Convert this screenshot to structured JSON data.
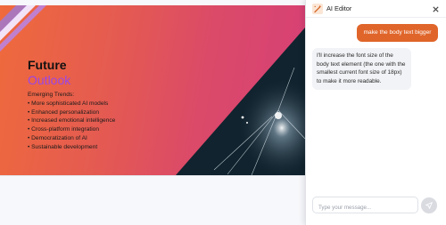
{
  "slide": {
    "title": "Future",
    "subtitle": "Outlook",
    "body_lines": [
      "Emerging Trends:",
      "• More sophisticated AI models",
      "• Enhanced personalization",
      "• Increased emotional intelligence",
      "• Cross-platform integration",
      "• Democratization of AI",
      "• Sustainable development"
    ]
  },
  "panel": {
    "title": "AI Editor",
    "logo_icon": "magic-wand-icon",
    "close_icon": "close-icon",
    "messages": {
      "user": "make the body text bigger",
      "assistant": "I'll increase the font size of the body text element (the one with the smallest current font size of 18px) to make it more readable."
    },
    "input": {
      "placeholder": "Type your message...",
      "value": ""
    },
    "send_icon": "send-icon"
  },
  "colors": {
    "accent": "#e0652a",
    "subtitle": "#9b46e6",
    "slide_gradient_start": "#ef6a3c",
    "slide_gradient_end": "#d63f78"
  }
}
